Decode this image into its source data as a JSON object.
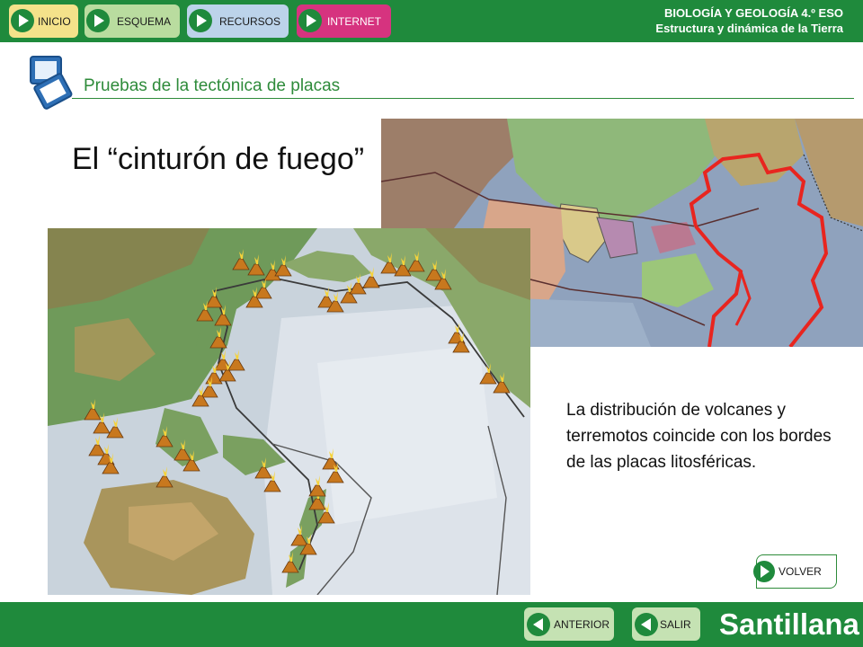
{
  "nav": {
    "inicio": "INICIO",
    "esquema": "ESQUEMA",
    "recursos": "RECURSOS",
    "internet": "INTERNET"
  },
  "course": {
    "title": "BIOLOGÍA Y GEOLOGÍA 4.º ESO",
    "unit": "Estructura y dinámica de la Tierra"
  },
  "section": {
    "title": "Pruebas de la tectónica de placas"
  },
  "slide": {
    "title": "El “cinturón de fuego”",
    "description": "La distribución de volcanes y terremotos coincide con los bordes de las placas litosféricas."
  },
  "buttons": {
    "volver": "VOLVER",
    "anterior": "ANTERIOR",
    "salir": "SALIR"
  },
  "brand": "Santillana",
  "colors": {
    "brand_green": "#1f8a3c",
    "internet_pink": "#d6337f",
    "ring_of_fire_red": "#e8251f"
  },
  "icons": {
    "nav_arrow": "play-triangle-icon",
    "back_arrow": "back-triangle-icon",
    "section_icon": "slides-icon",
    "volcano_marker": "volcano-icon"
  }
}
